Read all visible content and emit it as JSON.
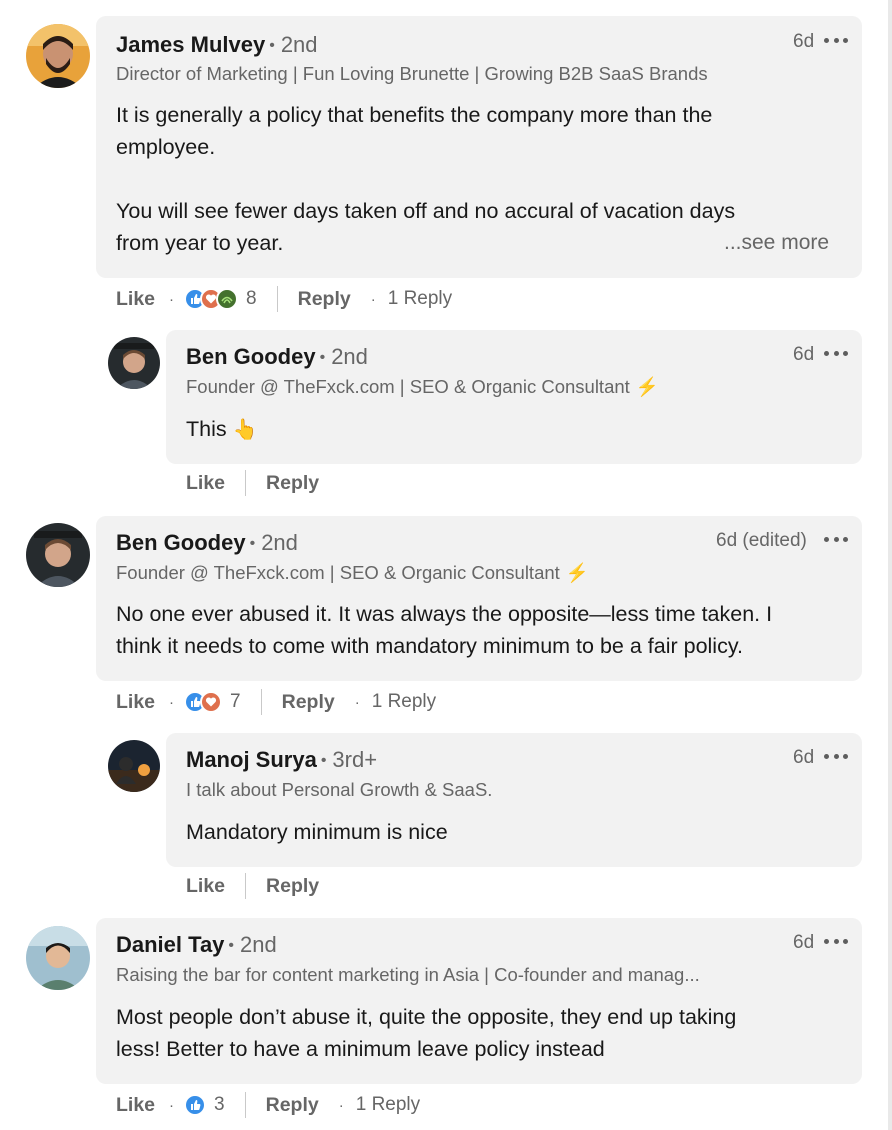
{
  "comments": [
    {
      "name": "James Mulvey",
      "degree": "2nd",
      "headline": "Director of Marketing | Fun Loving Brunette | Growing B2B SaaS Brands",
      "time": "6d",
      "body_lines": [
        "It is generally a policy that benefits the company more than the",
        "employee."
      ],
      "body_lines_2": [
        "You will see fewer days taken off and no accural of vacation days",
        "from year to year."
      ],
      "see_more": "...see more",
      "like_label": "Like",
      "reaction_count": "8",
      "reply_label": "Reply",
      "reply_count": "1 Reply",
      "reactions": [
        "like",
        "love",
        "support"
      ]
    },
    {
      "name": "Ben Goodey",
      "degree": "2nd",
      "headline": "Founder @ TheFxck.com | SEO & Organic Consultant",
      "time": "6d",
      "body": "This",
      "body_emoji": "👆",
      "like_label": "Like",
      "reply_label": "Reply"
    },
    {
      "name": "Ben Goodey",
      "degree": "2nd",
      "headline": "Founder @ TheFxck.com | SEO & Organic Consultant",
      "time": "6d (edited)",
      "body_lines": [
        "No one ever abused it. It was always the opposite—less time taken. I",
        "think it needs to come with mandatory minimum to be a fair policy."
      ],
      "like_label": "Like",
      "reaction_count": "7",
      "reply_label": "Reply",
      "reply_count": "1 Reply",
      "reactions": [
        "like",
        "love"
      ]
    },
    {
      "name": "Manoj Surya",
      "degree": "3rd+",
      "headline": "I talk about Personal Growth & SaaS.",
      "time": "6d",
      "body": "Mandatory minimum is nice",
      "like_label": "Like",
      "reply_label": "Reply"
    },
    {
      "name": "Daniel Tay",
      "degree": "2nd",
      "headline": "Raising the bar for content marketing in Asia | Co-founder and manag...",
      "time": "6d",
      "body_lines": [
        "Most people don’t abuse it, quite the opposite, they end up taking",
        "less! Better to have a minimum leave policy instead"
      ],
      "like_label": "Like",
      "reaction_count": "3",
      "reply_label": "Reply",
      "reply_count": "1 Reply",
      "reactions": [
        "like"
      ]
    }
  ],
  "colors": {
    "bubble": "#f2f2f2",
    "like_blue": "#378fe9",
    "love_red": "#df704d",
    "support_green": "#44712e",
    "bolt": "#f5c518"
  }
}
